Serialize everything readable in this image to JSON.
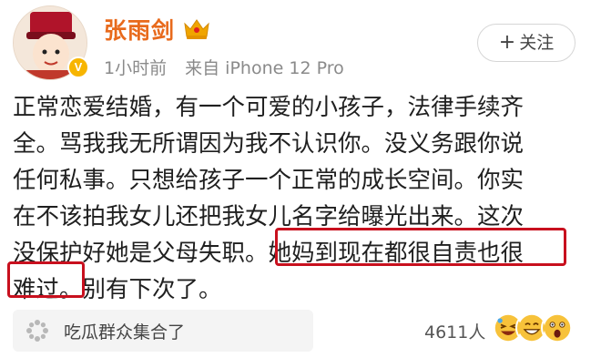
{
  "header": {
    "username": "张雨剑",
    "verified_badge": "V",
    "time_ago": "1小时前",
    "source": "来自 iPhone 12 Pro",
    "follow_label": "关注",
    "follow_icon": "plus-icon"
  },
  "post": {
    "lines": [
      "正常恋爱结婚，有一个可爱的小孩子，法律手续齐",
      "全。骂我我无所谓因为我不认识你。没义务跟你说",
      "任何私事。只想给孩子一个正常的成长空间。你实",
      "在不该拍我女儿还把我女儿名字给曝光出来。这次",
      "没保护好她是父母失职。她妈到现在都很自责也很",
      "难过。别有下次了。"
    ],
    "highlight_color": "#c8101e"
  },
  "footer": {
    "topic_label": "吃瓜群众集合了",
    "topic_icon": "flower-icon",
    "reaction_count": "4611人",
    "reaction_icons": [
      "laugh-emoji-icon",
      "grin-emoji-icon",
      "surprised-emoji-icon"
    ]
  },
  "colors": {
    "username": "#e86a1c",
    "meta": "#8a8a8a",
    "badge": "#f7b500",
    "highlight": "#c8101e"
  }
}
